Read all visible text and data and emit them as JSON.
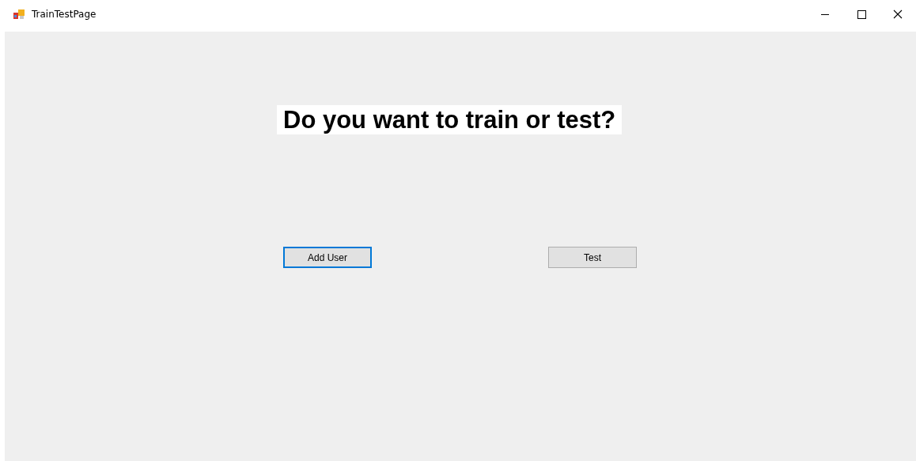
{
  "window": {
    "title": "TrainTestPage"
  },
  "heading": "Do you want to train or test?",
  "buttons": [
    {
      "label": "Add User",
      "focused": true
    },
    {
      "label": "Test",
      "focused": false
    }
  ]
}
